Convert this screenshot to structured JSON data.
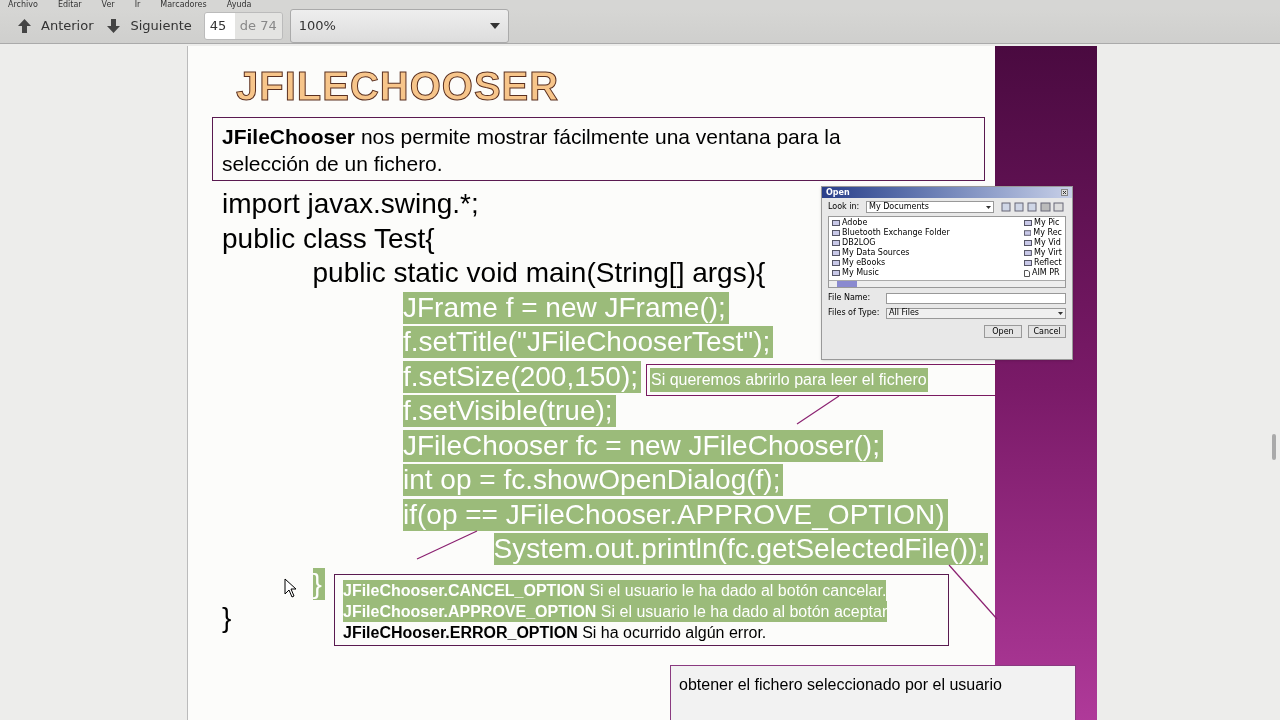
{
  "menu": [
    "Archivo",
    "Editar",
    "Ver",
    "Ir",
    "Marcadores",
    "Ayuda"
  ],
  "toolbar": {
    "previous": "Anterior",
    "next": "Siguiente",
    "page": "45",
    "page_total": "de 74",
    "zoom": "100%"
  },
  "slide": {
    "title": "JFILECHOOSER",
    "intro": "**JFileChooser** nos permite mostrar fácilmente una ventana para la selección de un fichero.",
    "code_lines": [
      {
        "text": "import javax.swing.*;",
        "selected": false
      },
      {
        "text": "public class Test{",
        "selected": false
      },
      {
        "text": "\tpublic static void main(String[] args){",
        "selected": false
      },
      {
        "text": "\t\tJFrame f = new JFrame();",
        "selected": true
      },
      {
        "text": "\t\tf.setTitle(\"JFileChooserTest\");",
        "selected": true
      },
      {
        "text": "\t\tf.setSize(200,150);",
        "selected": true
      },
      {
        "text": "\t\tf.setVisible(true);",
        "selected": true
      },
      {
        "text": "\t\tJFileChooser fc = new JFileChooser();",
        "selected": true
      },
      {
        "text": "\t\tint op = fc.showOpenDialog(f);",
        "selected": true
      },
      {
        "text": "\t\tif(op == JFileChooser.APPROVE_OPTION)",
        "selected": true
      },
      {
        "text": "\t\t\tSystem.out.println(fc.getSelectedFile());",
        "selected": true
      },
      {
        "text": "\t}",
        "selected": true
      },
      {
        "text": "}",
        "selected": false
      }
    ],
    "open_callout": {
      "text": "Si queremos abrirlo para leer el fichero",
      "selected": true
    },
    "options": [
      {
        "name": "JFileChooser.CANCEL_OPTION",
        "text": "Si el usuario le ha dado al botón cancelar.",
        "selected": true
      },
      {
        "name": "JFileChooser.APPROVE_OPTION",
        "text": "Si el usuario le ha dado al botón aceptar",
        "selected": true
      },
      {
        "name": "JFileCHooser.ERROR_OPTION",
        "text": "Si ha ocurrido algún error.",
        "selected": false
      }
    ],
    "selected_file_callout": "obtener el fichero seleccionado por el usuario",
    "file_dialog": {
      "title": "Open",
      "look_in_label": "Look in:",
      "look_in": "My Documents",
      "files": [
        {
          "name": "Adobe",
          "kind": "folder"
        },
        {
          "name": "Bluetooth Exchange Folder",
          "kind": "folder"
        },
        {
          "name": "DB2LOG",
          "kind": "folder"
        },
        {
          "name": "My Data Sources",
          "kind": "folder"
        },
        {
          "name": "My eBooks",
          "kind": "folder"
        },
        {
          "name": "My Music",
          "kind": "folder"
        }
      ],
      "files_right": [
        {
          "name": "My Pic",
          "kind": "folder"
        },
        {
          "name": "My Rec",
          "kind": "folder"
        },
        {
          "name": "My Vid",
          "kind": "folder"
        },
        {
          "name": "My Virt",
          "kind": "folder"
        },
        {
          "name": "Reflect",
          "kind": "folder"
        },
        {
          "name": "AIM PR",
          "kind": "file"
        }
      ],
      "file_name_label": "File Name:",
      "file_type_label": "Files of Type:",
      "file_type": "All Files",
      "buttons": [
        "Open",
        "Cancel"
      ]
    }
  }
}
